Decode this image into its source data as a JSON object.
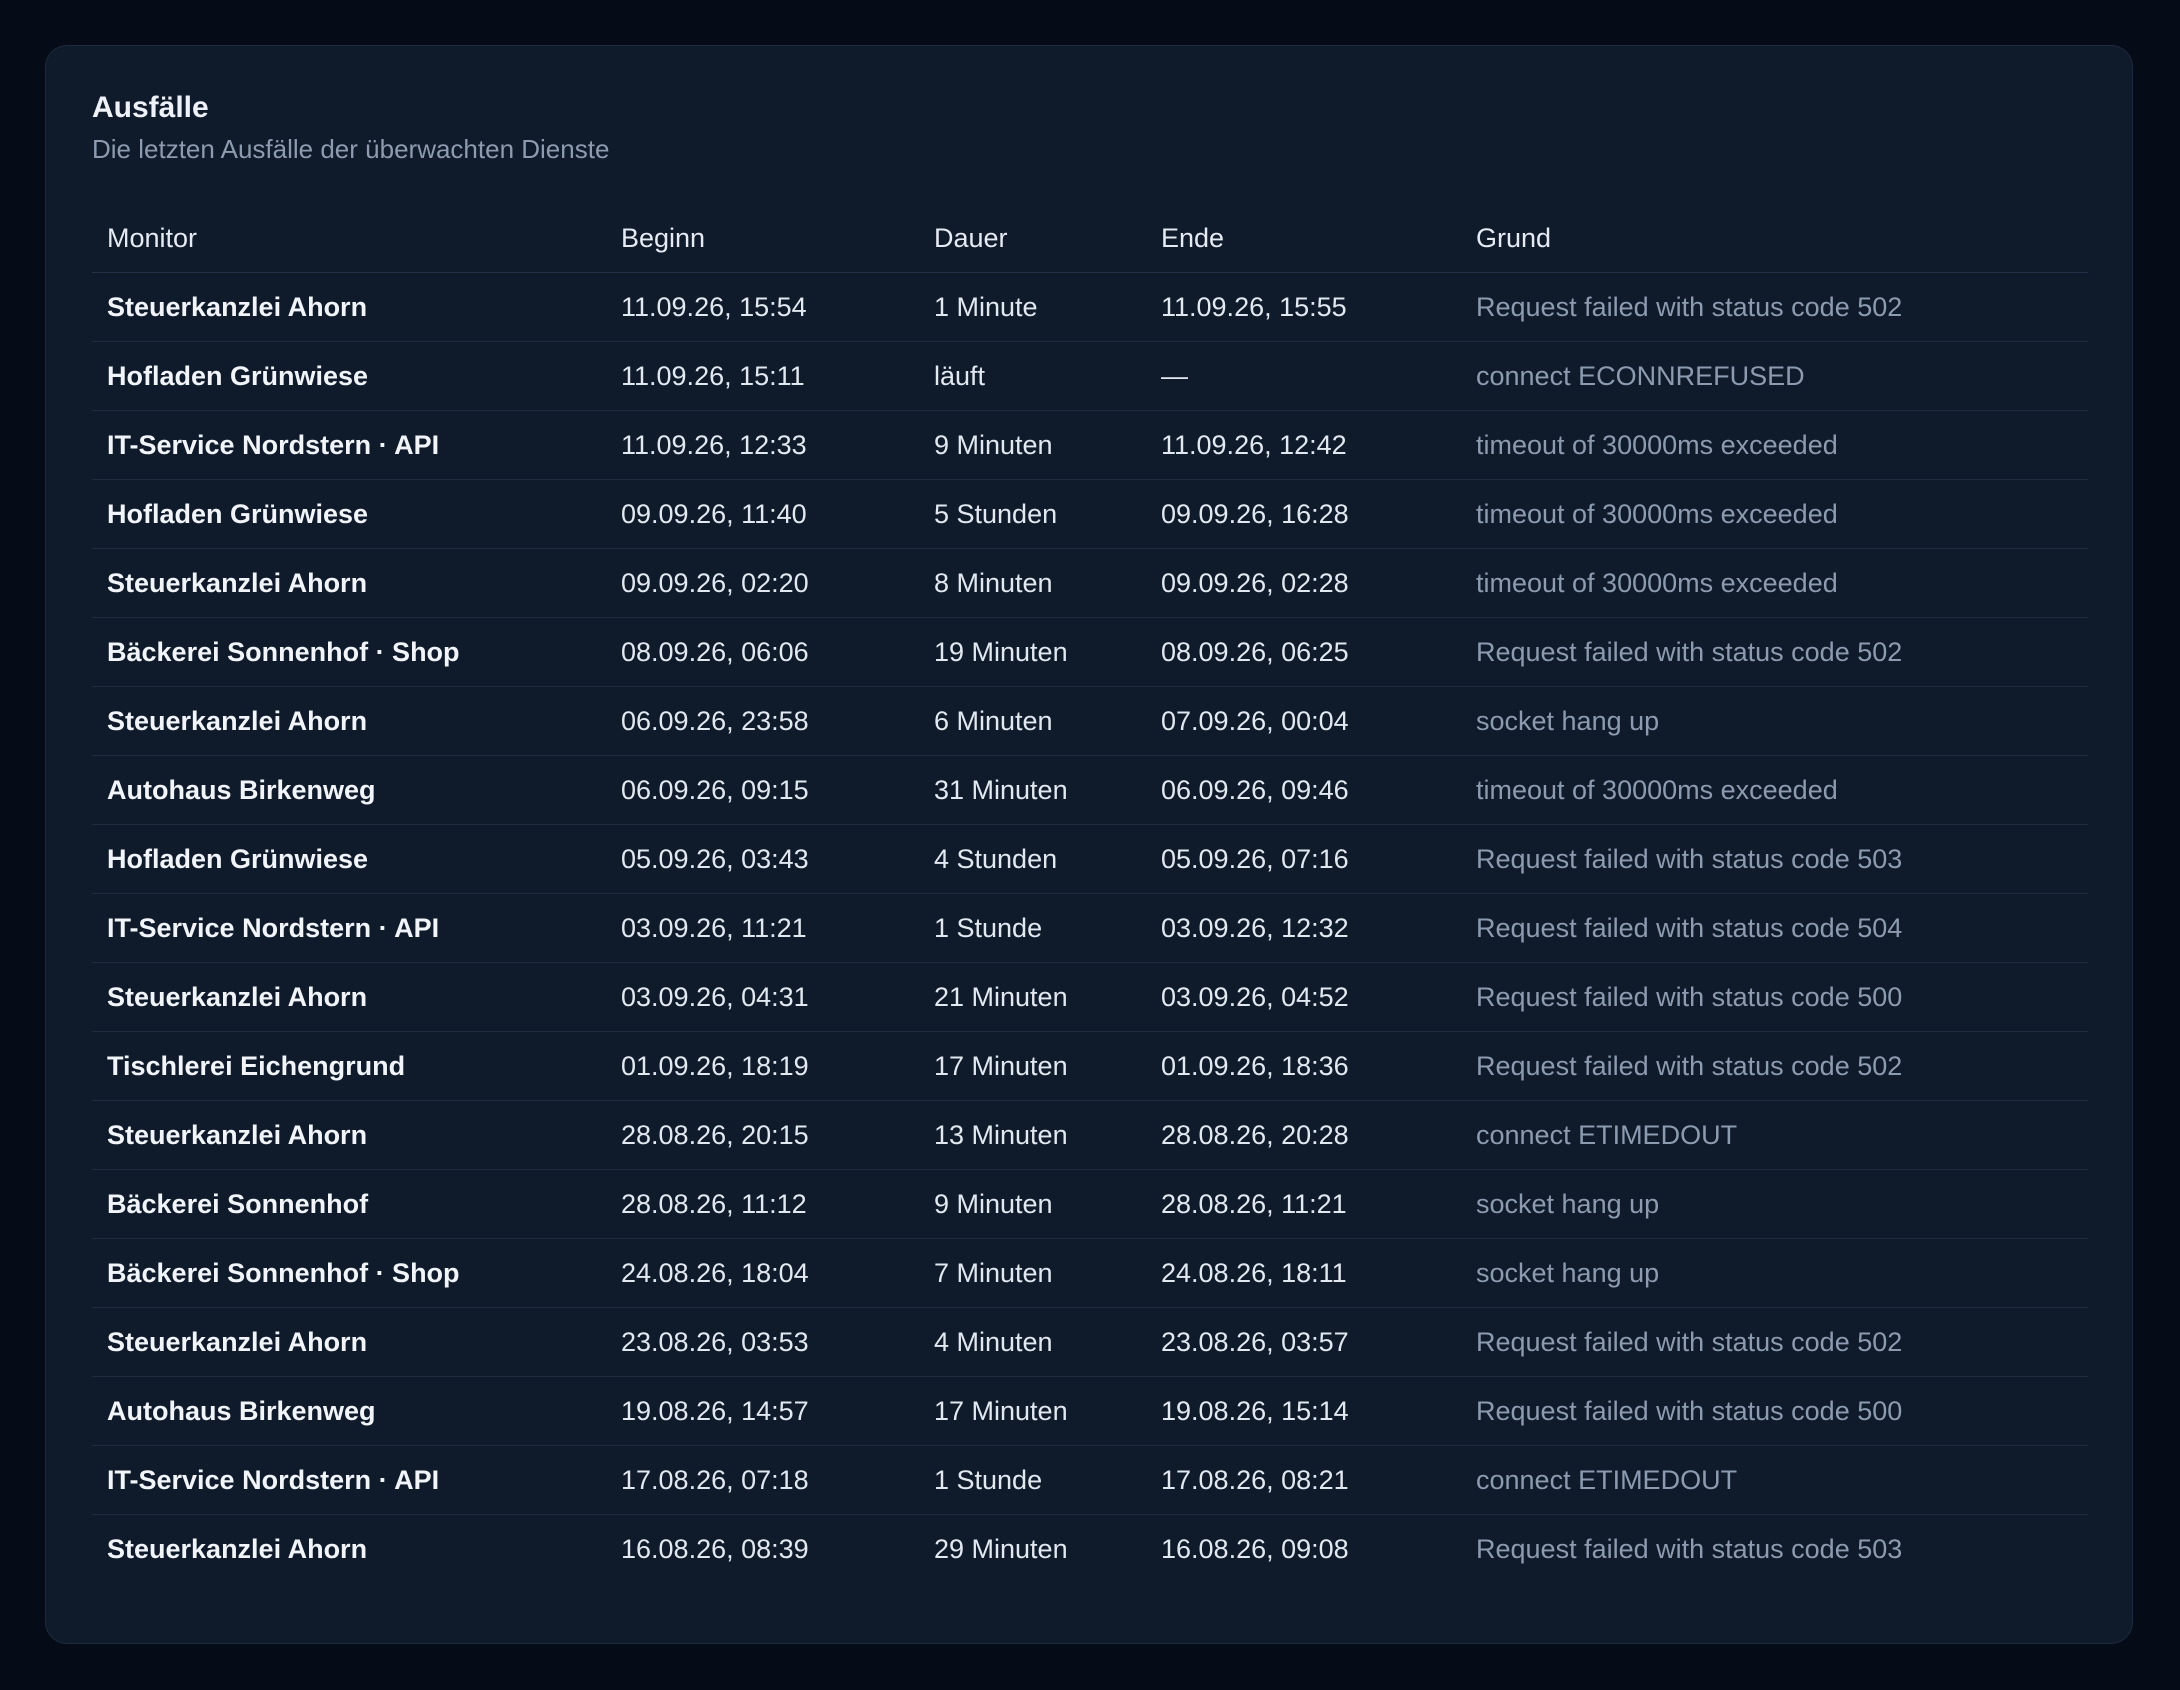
{
  "card": {
    "title": "Ausfälle",
    "subtitle": "Die letzten Ausfälle der überwachten Dienste"
  },
  "table": {
    "headers": [
      "Monitor",
      "Beginn",
      "Dauer",
      "Ende",
      "Grund"
    ],
    "rows": [
      [
        "Steuerkanzlei Ahorn",
        "11.09.26, 15:54",
        "1 Minute",
        "11.09.26, 15:55",
        "Request failed with status code 502"
      ],
      [
        "Hofladen Grünwiese",
        "11.09.26, 15:11",
        "läuft",
        "—",
        "connect ECONNREFUSED"
      ],
      [
        "IT-Service Nordstern · API",
        "11.09.26, 12:33",
        "9 Minuten",
        "11.09.26, 12:42",
        "timeout of 30000ms exceeded"
      ],
      [
        "Hofladen Grünwiese",
        "09.09.26, 11:40",
        "5 Stunden",
        "09.09.26, 16:28",
        "timeout of 30000ms exceeded"
      ],
      [
        "Steuerkanzlei Ahorn",
        "09.09.26, 02:20",
        "8 Minuten",
        "09.09.26, 02:28",
        "timeout of 30000ms exceeded"
      ],
      [
        "Bäckerei Sonnenhof · Shop",
        "08.09.26, 06:06",
        "19 Minuten",
        "08.09.26, 06:25",
        "Request failed with status code 502"
      ],
      [
        "Steuerkanzlei Ahorn",
        "06.09.26, 23:58",
        "6 Minuten",
        "07.09.26, 00:04",
        "socket hang up"
      ],
      [
        "Autohaus Birkenweg",
        "06.09.26, 09:15",
        "31 Minuten",
        "06.09.26, 09:46",
        "timeout of 30000ms exceeded"
      ],
      [
        "Hofladen Grünwiese",
        "05.09.26, 03:43",
        "4 Stunden",
        "05.09.26, 07:16",
        "Request failed with status code 503"
      ],
      [
        "IT-Service Nordstern · API",
        "03.09.26, 11:21",
        "1 Stunde",
        "03.09.26, 12:32",
        "Request failed with status code 504"
      ],
      [
        "Steuerkanzlei Ahorn",
        "03.09.26, 04:31",
        "21 Minuten",
        "03.09.26, 04:52",
        "Request failed with status code 500"
      ],
      [
        "Tischlerei Eichengrund",
        "01.09.26, 18:19",
        "17 Minuten",
        "01.09.26, 18:36",
        "Request failed with status code 502"
      ],
      [
        "Steuerkanzlei Ahorn",
        "28.08.26, 20:15",
        "13 Minuten",
        "28.08.26, 20:28",
        "connect ETIMEDOUT"
      ],
      [
        "Bäckerei Sonnenhof",
        "28.08.26, 11:12",
        "9 Minuten",
        "28.08.26, 11:21",
        "socket hang up"
      ],
      [
        "Bäckerei Sonnenhof · Shop",
        "24.08.26, 18:04",
        "7 Minuten",
        "24.08.26, 18:11",
        "socket hang up"
      ],
      [
        "Steuerkanzlei Ahorn",
        "23.08.26, 03:53",
        "4 Minuten",
        "23.08.26, 03:57",
        "Request failed with status code 502"
      ],
      [
        "Autohaus Birkenweg",
        "19.08.26, 14:57",
        "17 Minuten",
        "19.08.26, 15:14",
        "Request failed with status code 500"
      ],
      [
        "IT-Service Nordstern · API",
        "17.08.26, 07:18",
        "1 Stunde",
        "17.08.26, 08:21",
        "connect ETIMEDOUT"
      ],
      [
        "Steuerkanzlei Ahorn",
        "16.08.26, 08:39",
        "29 Minuten",
        "16.08.26, 09:08",
        "Request failed with status code 503"
      ]
    ]
  }
}
